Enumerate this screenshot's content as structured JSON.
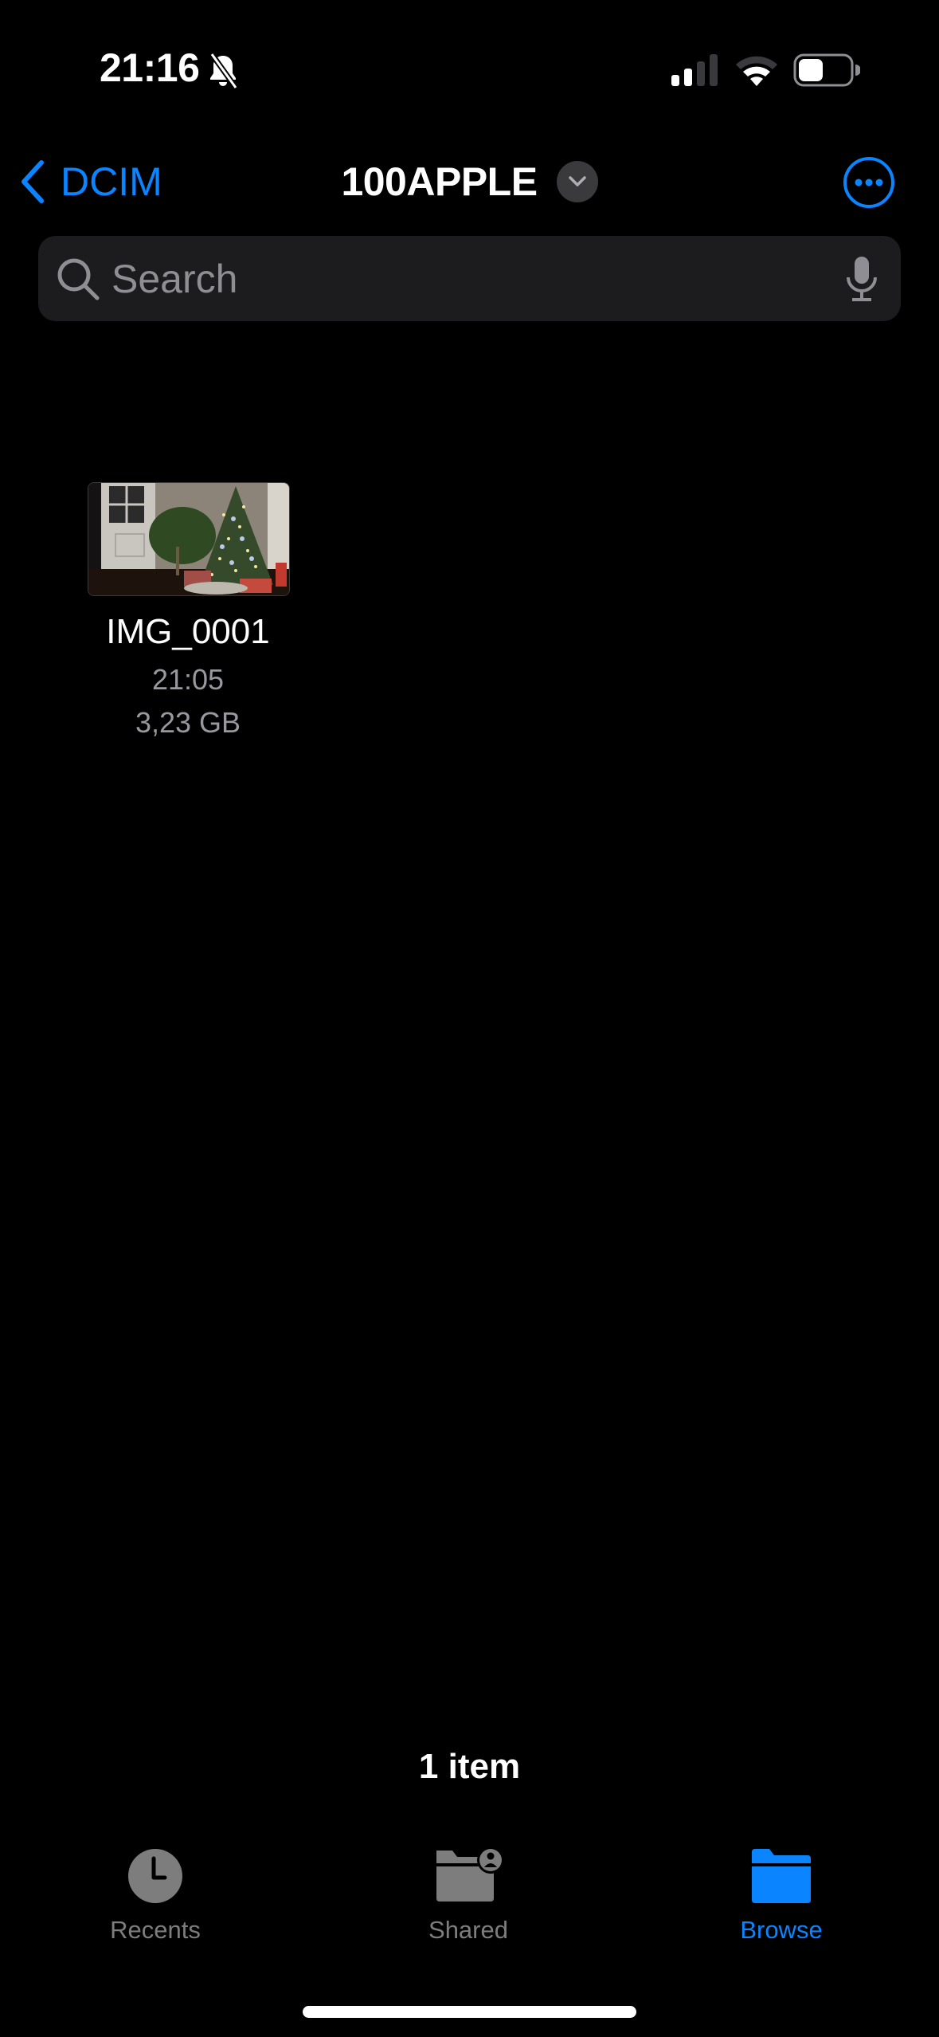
{
  "status_bar": {
    "time": "21:16",
    "silent_mode": true,
    "signal_bars_active": 2,
    "signal_bars_total": 4,
    "battery_level": 0.5
  },
  "nav": {
    "back_label": "DCIM",
    "title": "100APPLE"
  },
  "search": {
    "placeholder": "Search",
    "value": ""
  },
  "files": [
    {
      "name": "IMG_0001",
      "time": "21:05",
      "size": "3,23 GB",
      "thumbnail": "christmas-tree-room-photo"
    }
  ],
  "footer": {
    "item_count": "1 item"
  },
  "tabs": [
    {
      "label": "Recents",
      "icon": "clock-icon",
      "active": false
    },
    {
      "label": "Shared",
      "icon": "shared-folder-icon",
      "active": false
    },
    {
      "label": "Browse",
      "icon": "folder-icon",
      "active": true
    }
  ],
  "colors": {
    "accent": "#0a84ff",
    "background": "#000000",
    "search_field": "#1c1c1e",
    "secondary_text": "#98989f",
    "inactive_tab": "#7d7d7d"
  }
}
